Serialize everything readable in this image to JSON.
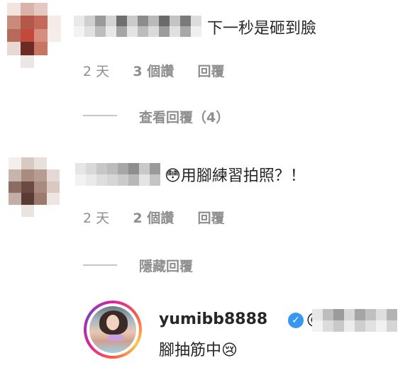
{
  "colors": {
    "text": "#262626",
    "meta": "#8e8e8e",
    "verified_blue": "#3897f0",
    "story_ring": [
      "#d6249f",
      "#fd5949",
      "#fdc84a",
      "#8a3ab9"
    ]
  },
  "comments": [
    {
      "text": "下一秒是砸到臉",
      "time": "2 天",
      "likes": "3 個讚",
      "reply": "回覆",
      "toggle": "查看回覆（4）"
    },
    {
      "text": "😳用腳練習拍照？！",
      "time": "2 天",
      "likes": "2 個讚",
      "reply": "回覆",
      "toggle": "隱藏回覆"
    }
  ],
  "reply": {
    "username": "yumibb8888",
    "mention_prefix": "@",
    "text": "腳抽筋中😢"
  }
}
